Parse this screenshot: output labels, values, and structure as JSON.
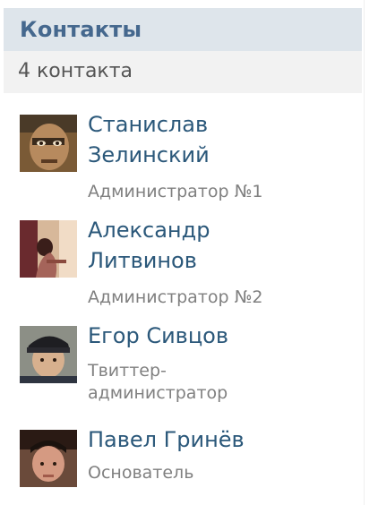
{
  "header": {
    "title": "Контакты",
    "count": "4 контакта"
  },
  "contacts": [
    {
      "name_line1": "Станислав",
      "name_line2": "Зелинский",
      "role": "Администратор №1",
      "avatar": "user-avatar-photo"
    },
    {
      "name_line1": "Александр",
      "name_line2": "Литвинов",
      "role": "Администратор №2",
      "avatar": "user-avatar-photo"
    },
    {
      "name_line1": "Егор Сивцов",
      "role_line1": "Твиттер-",
      "role_line2": "администратор",
      "avatar": "user-avatar-photo"
    },
    {
      "name_line1": "Павел Гринёв",
      "role": "Основатель",
      "avatar": "user-avatar-photo"
    }
  ],
  "colors": {
    "header_bg": "#dee5eb",
    "header_text": "#45688e",
    "subheader_bg": "#f2f2f2",
    "link": "#2b587a",
    "muted": "#808080"
  }
}
